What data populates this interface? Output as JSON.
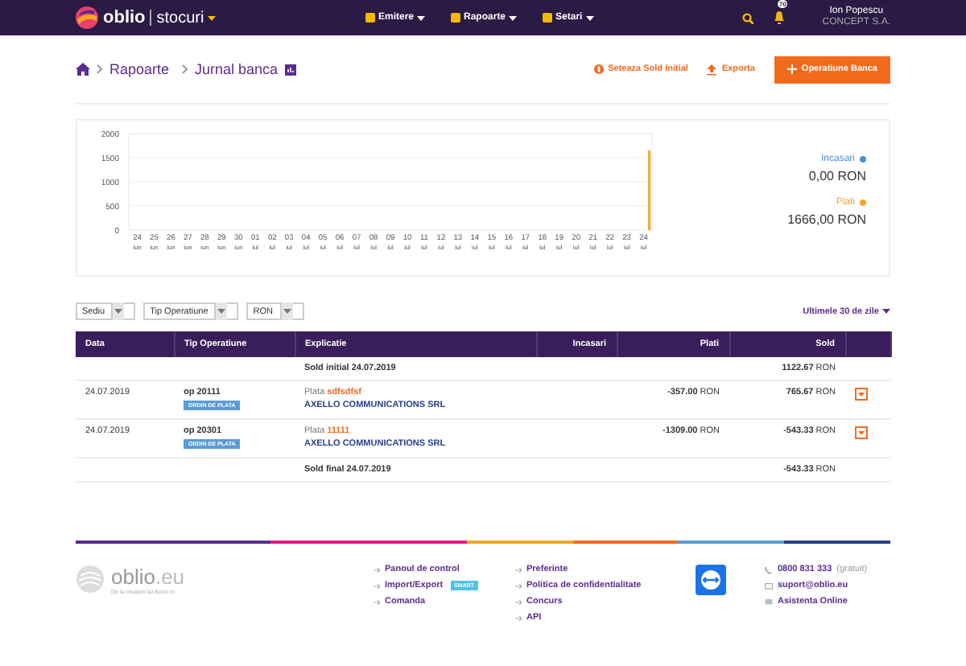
{
  "header": {
    "logo": "oblio",
    "product": "stocuri",
    "menu": [
      {
        "label": "Emitere"
      },
      {
        "label": "Rapoarte"
      },
      {
        "label": "Setari"
      }
    ],
    "notifications": "70",
    "user": {
      "name": "Ion Popescu",
      "company": "CONCEPT S.A."
    }
  },
  "breadcrumb": [
    "Rapoarte",
    "Jurnal banca"
  ],
  "actions": [
    {
      "label": "Seteaza Sold Initial",
      "kind": "initial"
    },
    {
      "label": "Exporta",
      "kind": "export"
    },
    {
      "label": "Operatiune Banca",
      "kind": "primary"
    }
  ],
  "chart_data": {
    "type": "bar",
    "grid": true,
    "categories": [
      "24 $_{iun}$",
      "25 $_{iun}$",
      "26 $_{iun}$",
      "27 $_{iun}$",
      "28 $_{iun}$",
      "29 $_{iun}$",
      "30 $_{iun}$",
      "01 $_{iul}$",
      "02 $_{iul}$",
      "03 $_{iul}$",
      "04 $_{iul}$",
      "05 $_{iul}$",
      "06 $_{iul}$",
      "07 $_{iul}$",
      "08 $_{iul}$",
      "09 $_{iul}$",
      "10 $_{iul}$",
      "11 $_{iul}$",
      "12 $_{iul}$",
      "13 $_{iul}$",
      "14 $_{iul}$",
      "15 $_{iul}$",
      "16 $_{iul}$",
      "17 $_{iul}$",
      "18 $_{iul}$",
      "19 $_{iul}$",
      "20 $_{iul}$",
      "21 $_{iul}$",
      "22 $_{iul}$",
      "23 $_{iul}$",
      "24 $_{iul}$"
    ],
    "series": [
      {
        "name": "Incasari",
        "color": "#4a90d9",
        "values": [
          0,
          0,
          0,
          0,
          0,
          0,
          0,
          0,
          0,
          0,
          0,
          0,
          0,
          0,
          0,
          0,
          0,
          0,
          0,
          0,
          0,
          0,
          0,
          0,
          0,
          0,
          0,
          0,
          0,
          0,
          0
        ]
      },
      {
        "name": "Plati",
        "color": "#f5a623",
        "values": [
          0,
          0,
          0,
          0,
          0,
          0,
          0,
          0,
          0,
          0,
          0,
          0,
          0,
          0,
          0,
          0,
          0,
          0,
          0,
          0,
          0,
          0,
          0,
          0,
          0,
          0,
          0,
          0,
          0,
          0,
          1650
        ]
      }
    ],
    "ylim": [
      0,
      2000
    ],
    "yticks": [
      0,
      500,
      1000,
      1500,
      2000
    ]
  },
  "summary": [
    "0,00 RON",
    "1666,00 RON"
  ],
  "filters": [
    "Sediu",
    "Tip Operatiune",
    "RON"
  ],
  "period": "Ultimele 30 de zile",
  "table": {
    "columns": [
      "Data",
      "Tip Operatiune",
      "Explicatie",
      "Incasari",
      "Plati",
      "Sold"
    ],
    "rows": [
      {
        "kind": "balance",
        "label": "Sold initial 24.07.2019",
        "sold": "**1122.67** RON"
      },
      {
        "kind": "operation",
        "date": "24.07.2019",
        "number": "op 20111",
        "badge": "ORDIN DE PLATA",
        "explanation": "Plata",
        "reference": "sdfsdfsf",
        "partner": "AXELLO COMMUNICATIONS SRL",
        "plati": "**-357.00** RON",
        "sold": "**765.67** RON"
      },
      {
        "kind": "operation",
        "date": "24.07.2019",
        "number": "op 20301",
        "badge": "ORDIN DE PLATA",
        "explanation": "Plata",
        "reference": "11111",
        "partner": "AXELLO COMMUNICATIONS SRL",
        "plati": "**-1309.00** RON",
        "sold": "**-543.33** RON"
      },
      {
        "kind": "balance",
        "label": "Sold final 24.07.2019",
        "sold": "**-543.33** RON"
      }
    ]
  },
  "footer": {
    "logo": "oblio",
    "logo_suffix": ".eu",
    "tagline": "De la creatorii lui Bizoo.ro",
    "links": [
      [
        {
          "label": "Panoul de control"
        },
        {
          "label": "Import/Export",
          "badge": "SMART"
        },
        {
          "label": "Comanda"
        }
      ],
      [
        {
          "label": "Preferinte"
        },
        {
          "label": "Politica de confidentialitate"
        },
        {
          "label": "Concurs"
        },
        {
          "label": "API"
        }
      ]
    ],
    "contacts": [
      {
        "kind": "phone",
        "label": "0800 831 333",
        "note": "(gratuit)"
      },
      {
        "kind": "mail",
        "label": "suport@oblio.eu"
      },
      {
        "kind": "chat",
        "label": "Asistenta Online"
      }
    ]
  }
}
